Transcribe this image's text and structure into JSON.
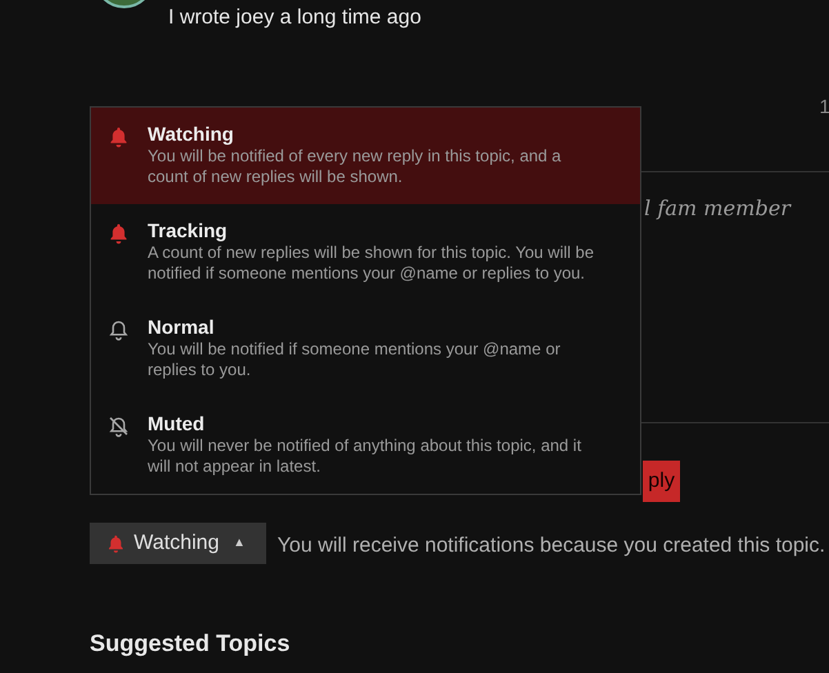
{
  "post": {
    "text": "I wrote joey a long time ago"
  },
  "side_post": {
    "counter": "1",
    "user_title": "l fam member"
  },
  "reply_button": {
    "label": "ply"
  },
  "notification_menu": {
    "options": [
      {
        "kind": "watching",
        "title": "Watching",
        "description": "You will be notified of every new reply in this topic, and a count of new replies will be shown.",
        "selected": true
      },
      {
        "kind": "tracking",
        "title": "Tracking",
        "description": "A count of new replies will be shown for this topic. You will be notified if someone mentions your @name or replies to you.",
        "selected": false
      },
      {
        "kind": "normal",
        "title": "Normal",
        "description": "You will be notified if someone mentions your @name or replies to you.",
        "selected": false
      },
      {
        "kind": "muted",
        "title": "Muted",
        "description": "You will never be notified of anything about this topic, and it will not appear in latest.",
        "selected": false
      }
    ]
  },
  "notification_button": {
    "kind": "watching",
    "label": "Watching",
    "caret": "▲"
  },
  "notification_reason": "You will receive notifications because you created this topic.",
  "suggested_heading": "Suggested Topics"
}
